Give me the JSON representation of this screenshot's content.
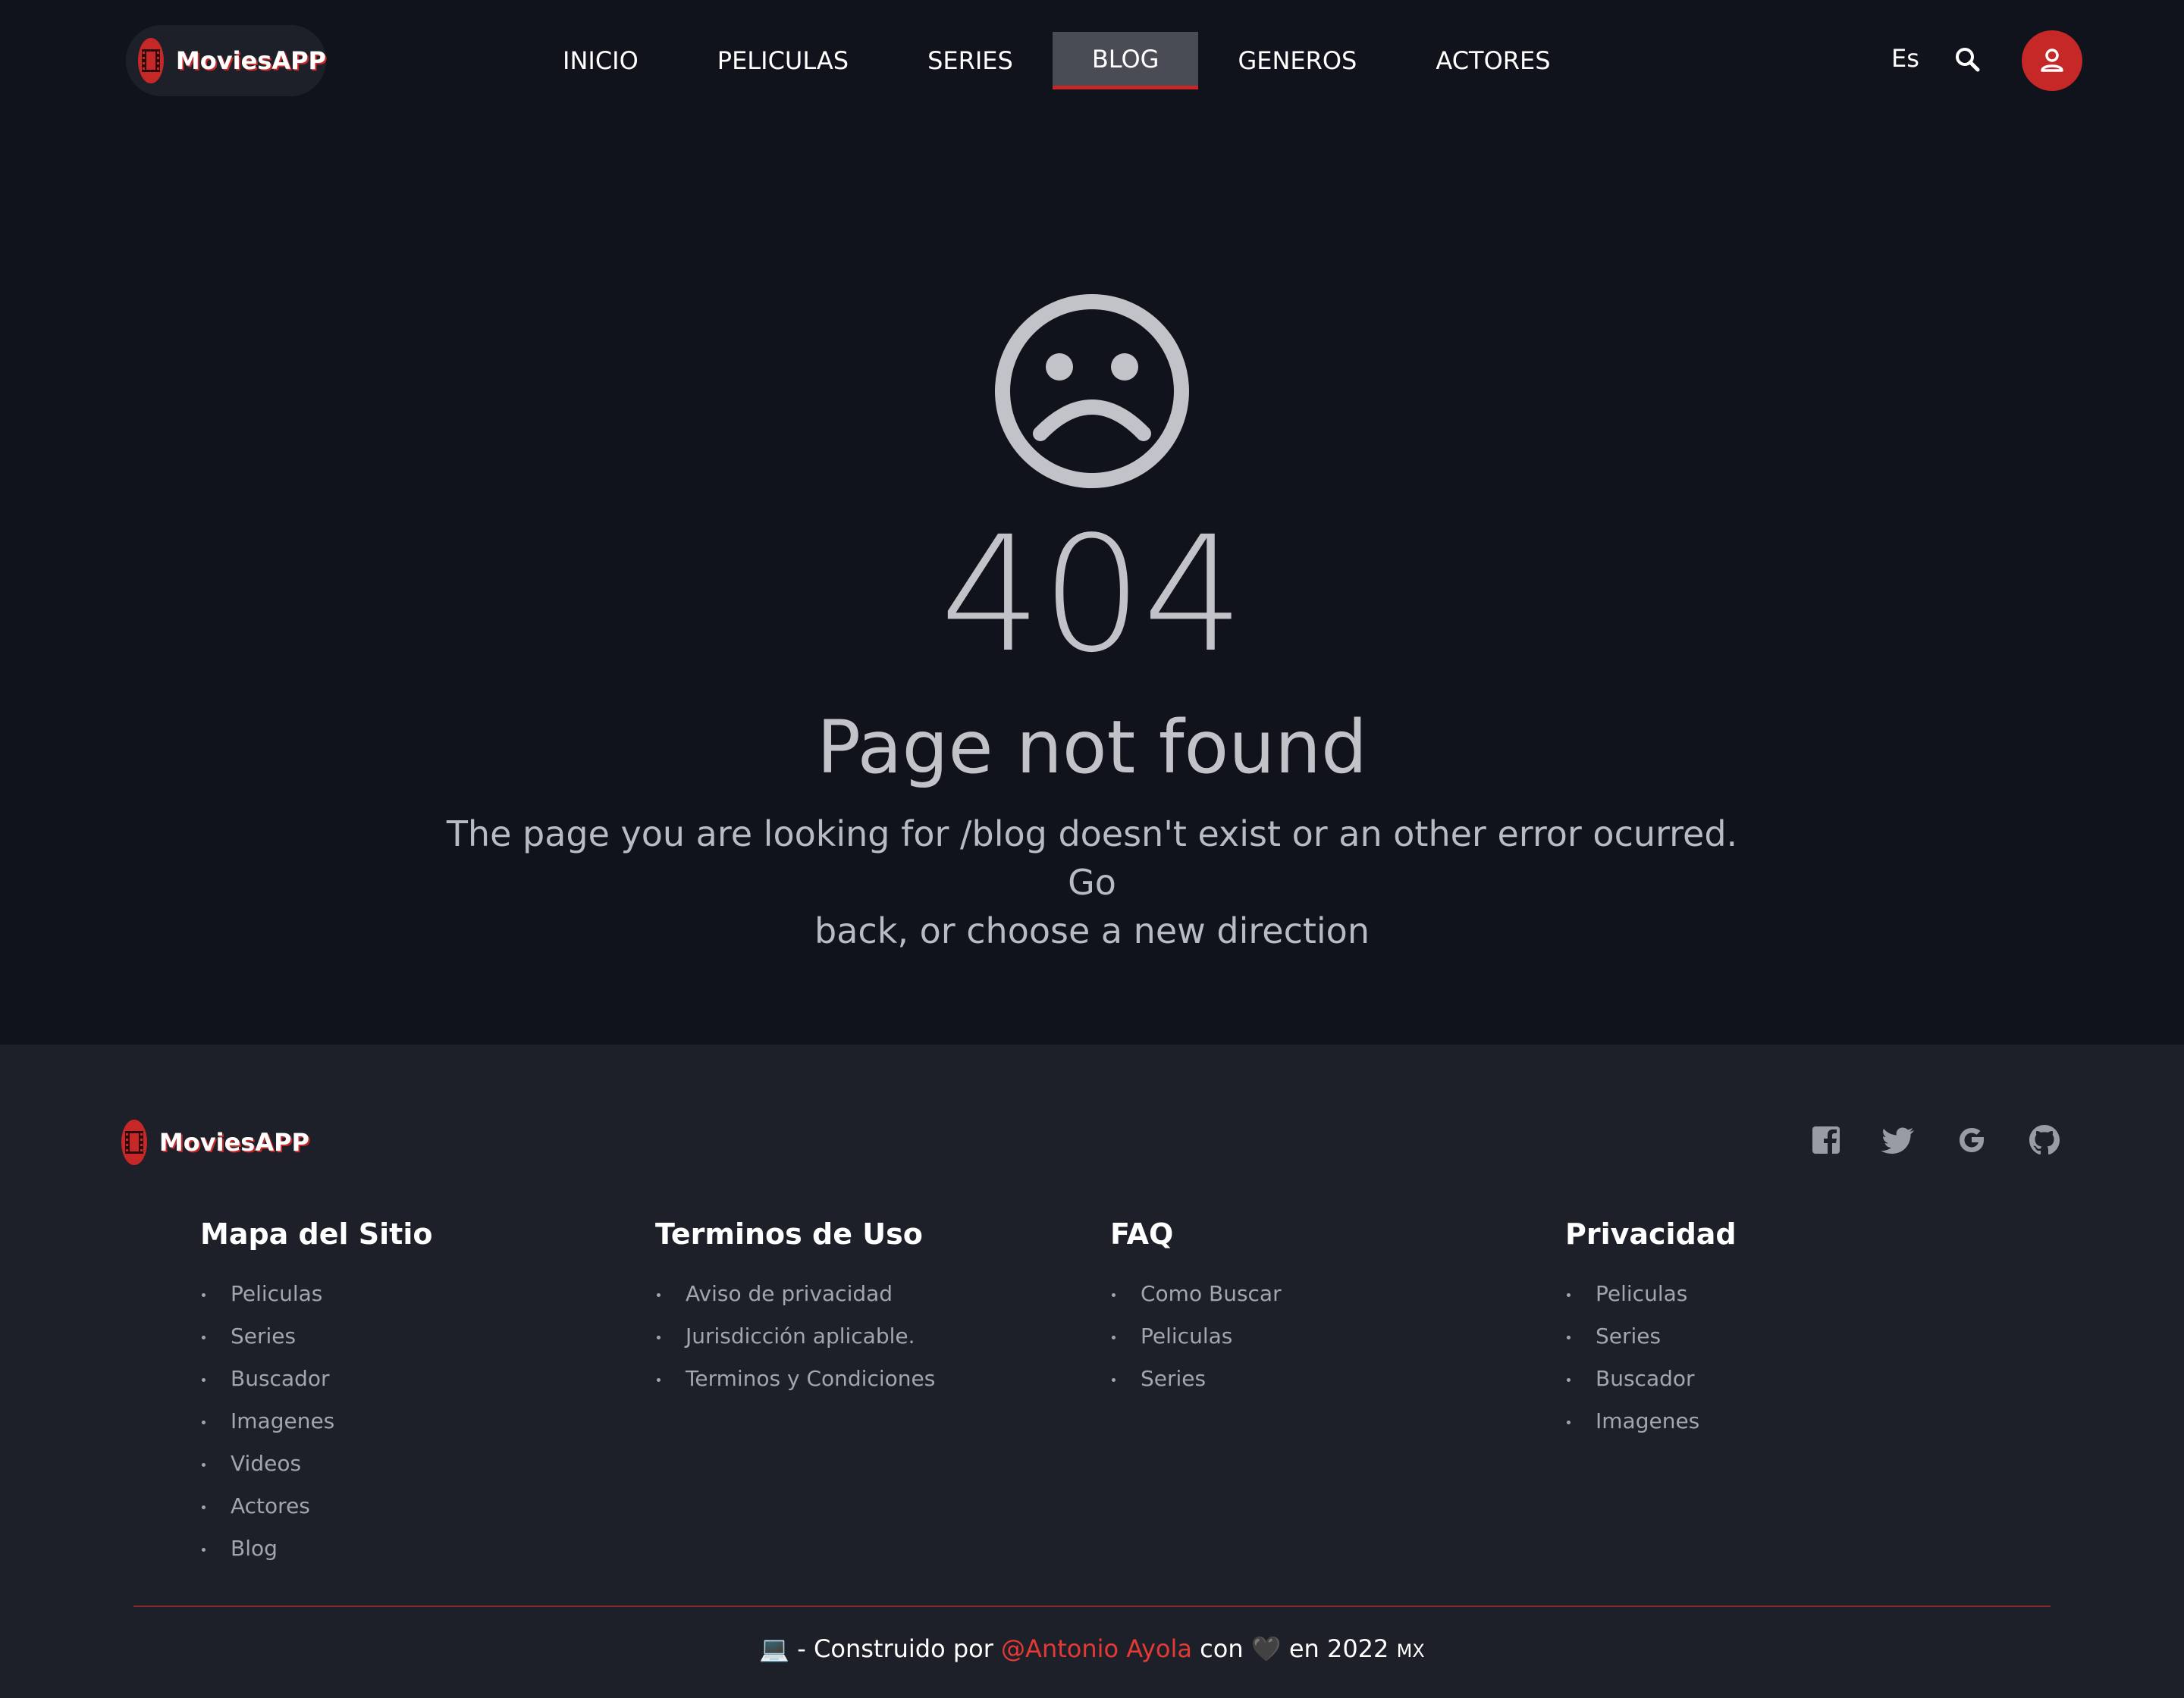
{
  "brand": {
    "name": "MoviesAPP",
    "accent_color": "#c62828",
    "logo_icon": "film-icon"
  },
  "nav": {
    "items": [
      {
        "label": "INICIO",
        "active": false
      },
      {
        "label": "PELICULAS",
        "active": false
      },
      {
        "label": "SERIES",
        "active": false
      },
      {
        "label": "BLOG",
        "active": true
      },
      {
        "label": "GENEROS",
        "active": false
      },
      {
        "label": "ACTORES",
        "active": false
      }
    ],
    "language": "Es",
    "search_icon": "search-icon",
    "user_icon": "user-icon"
  },
  "error": {
    "icon": "sad-face-icon",
    "code": "404",
    "title": "Page not found",
    "message_line1": "The page you are looking for /blog doesn't exist or an other error ocurred. Go",
    "message_line2": "back, or choose a new direction"
  },
  "footer": {
    "social_icons": [
      "facebook-icon",
      "twitter-icon",
      "google-icon",
      "github-icon"
    ],
    "columns": [
      {
        "title": "Mapa del Sitio",
        "links": [
          "Peliculas",
          "Series",
          "Buscador",
          "Imagenes",
          "Videos",
          "Actores",
          "Blog"
        ]
      },
      {
        "title": "Terminos de Uso",
        "links": [
          "Aviso de privacidad",
          "Jurisdicción aplicable.",
          "Terminos y Condiciones"
        ]
      },
      {
        "title": "FAQ",
        "links": [
          "Como Buscar",
          "Peliculas",
          "Series"
        ]
      },
      {
        "title": "Privacidad",
        "links": [
          "Peliculas",
          "Series",
          "Buscador",
          "Imagenes"
        ]
      }
    ],
    "credits": {
      "laptop": "💻",
      "prefix": "- Construido por",
      "author": "@Antonio Ayola",
      "with": "con",
      "heart": "🖤",
      "suffix": "en 2022",
      "country": "MX"
    }
  }
}
